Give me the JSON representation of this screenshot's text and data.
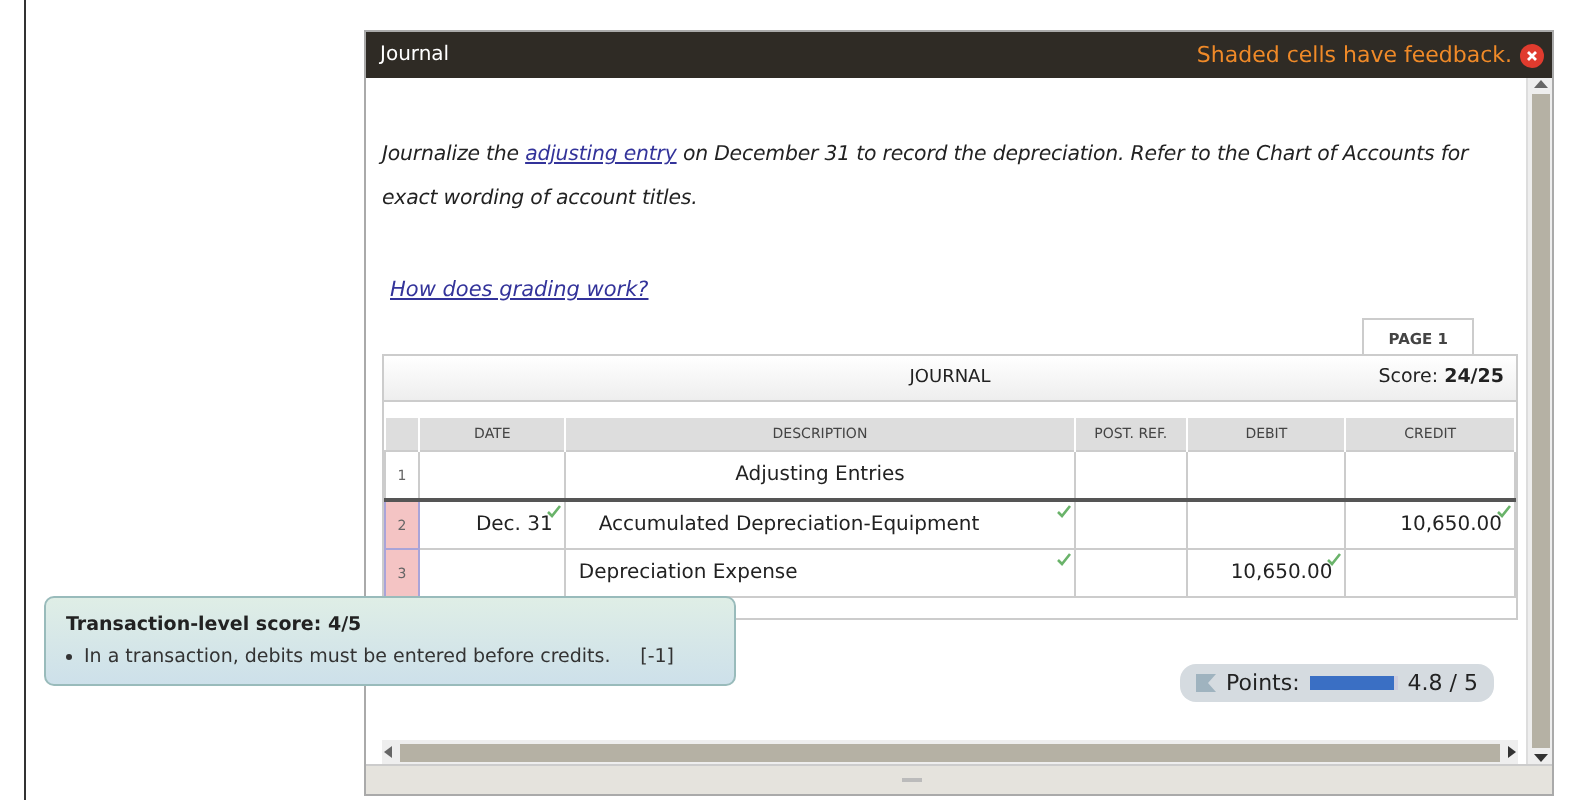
{
  "window": {
    "title": "Journal",
    "notice": "Shaded cells have feedback."
  },
  "instructions": {
    "before": "Journalize the",
    "link": "adjusting entry",
    "after": "on December 31 to record the depreciation. Refer to the Chart of Accounts for exact wording of account titles."
  },
  "help_link": "How does grading work?",
  "page_tabs": [
    {
      "label": "PAGE 1",
      "selected": true
    }
  ],
  "journal": {
    "title": "JOURNAL",
    "score_label": "Score:",
    "score": "24/25",
    "columns": [
      "DATE",
      "DESCRIPTION",
      "POST. REF.",
      "DEBIT",
      "CREDIT"
    ],
    "rows": [
      {
        "number": "1",
        "feedback": false,
        "kind": "heading",
        "cells": [
          {
            "correct": false
          },
          {
            "text": "Adjusting Entries",
            "correct": false
          },
          {
            "correct": false
          },
          {
            "correct": false
          },
          {
            "correct": false
          }
        ]
      },
      {
        "number": "2",
        "feedback": true,
        "kind": "credit",
        "cells": [
          {
            "text": "Dec. 31",
            "correct": true
          },
          {
            "text": "Accumulated Depreciation-Equipment",
            "correct": true
          },
          {
            "correct": false
          },
          {
            "correct": false
          },
          {
            "text": "10,650.00",
            "correct": true
          }
        ]
      },
      {
        "number": "3",
        "feedback": true,
        "kind": "debit",
        "cells": [
          {
            "correct": false
          },
          {
            "text": "Depreciation Expense",
            "correct": true
          },
          {
            "correct": false
          },
          {
            "text": "10,650.00",
            "correct": true
          },
          {
            "correct": false
          }
        ]
      }
    ]
  },
  "feedback_tip": {
    "title": "Transaction-level score: 4/5",
    "items": [
      {
        "text": "In a transaction, debits must be entered before credits.",
        "penalty": "[-1]"
      }
    ]
  },
  "points": {
    "label": "Points:",
    "level": 0.96,
    "reading": "4.8 / 5"
  }
}
